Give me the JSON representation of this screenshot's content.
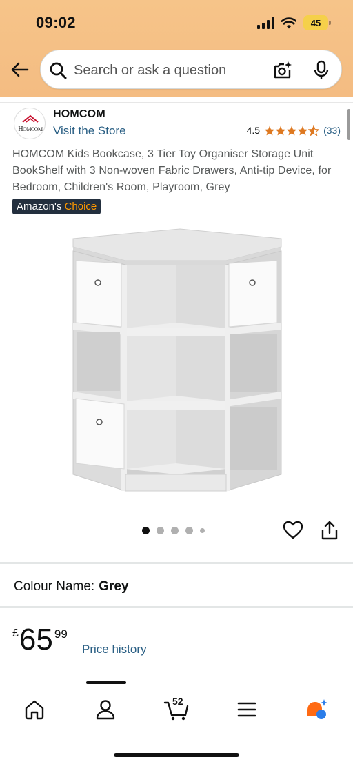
{
  "status_bar": {
    "time": "09:02",
    "battery": "45"
  },
  "search": {
    "placeholder": "Search or ask a question"
  },
  "brand": {
    "name": "HOMCOM",
    "visit_store": "Visit the Store",
    "logo_text": "HOMCOM"
  },
  "rating": {
    "value": "4.5",
    "count": "(33)",
    "stars": 4.5
  },
  "product": {
    "title": "HOMCOM Kids Bookcase, 3 Tier Toy Organiser Storage Unit BookShelf with 3 Non-woven Fabric Drawers, Anti-tip Device, for Bedroom, Children's Room, Playroom, Grey",
    "badge_prefix": "Amazon's",
    "badge_suffix": "Choice",
    "image_count": 5,
    "active_image": 1
  },
  "colour": {
    "label": "Colour Name:",
    "value": "Grey"
  },
  "price": {
    "currency": "£",
    "whole": "65",
    "fraction": "99",
    "history_link": "Price history"
  },
  "bottom_nav": {
    "cart_count": "52",
    "items": [
      "home-icon",
      "account-icon",
      "cart-icon",
      "menu-icon",
      "rufus-icon"
    ]
  },
  "colors": {
    "header": "#f6c489",
    "link": "#2a5f84",
    "star": "#de7921",
    "badge": "#232f3e"
  }
}
